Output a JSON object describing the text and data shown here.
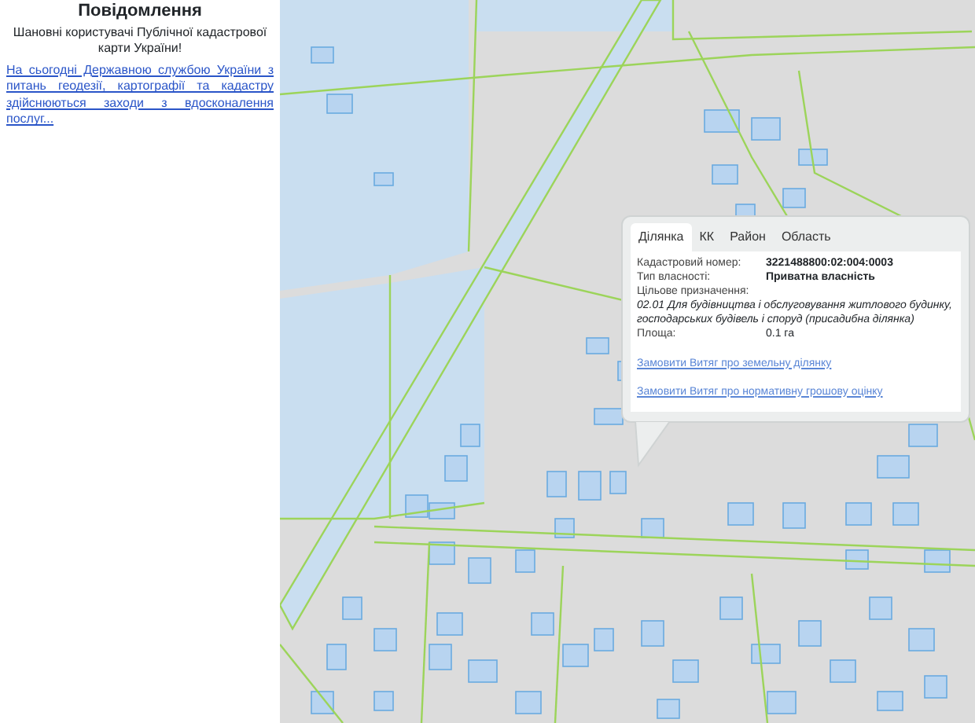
{
  "notice": {
    "title": "Повідомлення",
    "greeting": "Шановні користувачі Публічної кадастрової карти України!",
    "link": "На сьогодні Державною службою України з питань геодезії, картографії та кадастру здійснюються заходи з вдосконалення послуг..."
  },
  "popup": {
    "tabs": [
      {
        "label": "Ділянка",
        "selected": true
      },
      {
        "label": "КК",
        "selected": false
      },
      {
        "label": "Район",
        "selected": false
      },
      {
        "label": "Область",
        "selected": false
      }
    ],
    "fields": [
      {
        "label": "Кадастровий номер:",
        "value": "3221488800:02:004:0003",
        "kind": "bold"
      },
      {
        "label": "Тип власності:",
        "value": "Приватна власність",
        "kind": "bold"
      },
      {
        "label": "Цільове призначення:",
        "value": "02.01 Для будівництва і обслуговування житлового будинку, господарських будівель і споруд (присадибна ділянка)",
        "kind": "wide"
      },
      {
        "label": "Площа:",
        "value": "0.1 га",
        "kind": "plain"
      }
    ],
    "links": [
      "Замовити Витяг про земельну ділянку",
      "Замовити Витяг про нормативну грошову оцінку"
    ]
  }
}
